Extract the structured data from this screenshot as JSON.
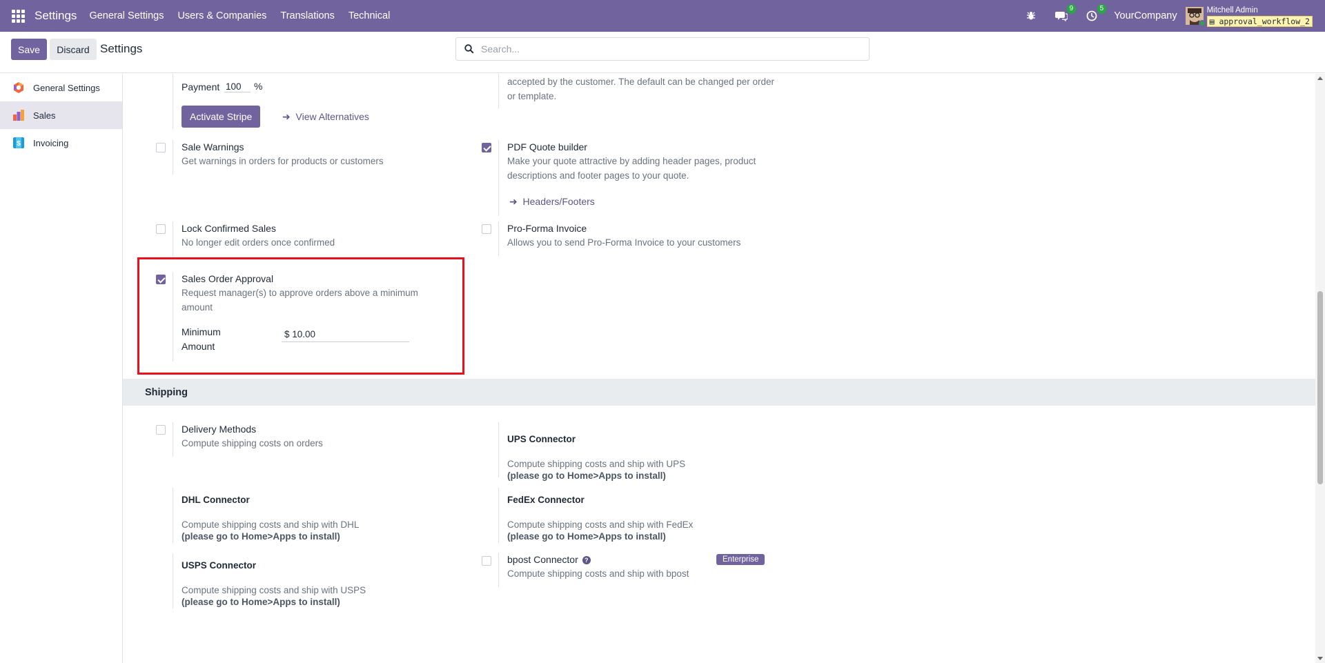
{
  "navbar": {
    "app_name": "Settings",
    "menu": [
      "General Settings",
      "Users & Companies",
      "Translations",
      "Technical"
    ],
    "messages_count": "9",
    "activities_count": "5",
    "company": "YourCompany",
    "user_name": "Mitchell Admin",
    "database": "approval_workflow_2"
  },
  "control": {
    "save": "Save",
    "discard": "Discard",
    "title": "Settings",
    "search_placeholder": "Search..."
  },
  "sidebar": {
    "items": [
      {
        "label": "General Settings",
        "icon": "general-settings-icon"
      },
      {
        "label": "Sales",
        "icon": "sales-icon",
        "active": true
      },
      {
        "label": "Invoicing",
        "icon": "invoicing-icon"
      }
    ]
  },
  "payment": {
    "label": "Payment",
    "value": "100",
    "unit": "%",
    "activate_button": "Activate Stripe",
    "alternatives_link": "View Alternatives"
  },
  "quote_validity_desc": "accepted by the customer. The default can be changed per order or template.",
  "settings": {
    "sale_warnings": {
      "title": "Sale Warnings",
      "desc": "Get warnings in orders for products or customers",
      "checked": false
    },
    "pdf_quote_builder": {
      "title": "PDF Quote builder",
      "desc": "Make your quote attractive by adding header pages, product descriptions and footer pages to your quote.",
      "link": "Headers/Footers",
      "checked": true
    },
    "lock_confirmed": {
      "title": "Lock Confirmed Sales",
      "desc": "No longer edit orders once confirmed",
      "checked": false
    },
    "pro_forma": {
      "title": "Pro-Forma Invoice",
      "desc": "Allows you to send Pro-Forma Invoice to your customers",
      "checked": false
    },
    "order_approval": {
      "title": "Sales Order Approval",
      "desc": "Request manager(s) to approve orders above a minimum amount",
      "min_label": "Minimum Amount",
      "min_value": "$ 10.00",
      "checked": true
    }
  },
  "shipping": {
    "section_title": "Shipping",
    "delivery_methods": {
      "title": "Delivery Methods",
      "desc": "Compute shipping costs on orders",
      "checked": false
    },
    "ups": {
      "title": "UPS Connector",
      "desc": "Compute shipping costs and ship with UPS",
      "note": "(please go to Home>Apps to install)"
    },
    "dhl": {
      "title": "DHL Connector",
      "desc": "Compute shipping costs and ship with DHL",
      "note": "(please go to Home>Apps to install)"
    },
    "fedex": {
      "title": "FedEx Connector",
      "desc": "Compute shipping costs and ship with FedEx",
      "note": "(please go to Home>Apps to install)"
    },
    "bpost": {
      "title": "bpost Connector",
      "desc": "Compute shipping costs and ship with bpost",
      "badge": "Enterprise",
      "help": "?"
    },
    "usps": {
      "title": "USPS Connector",
      "desc": "Compute shipping costs and ship with USPS",
      "note": "(please go to Home>Apps to install)"
    }
  },
  "colors": {
    "brand": "#71639e",
    "highlight": "#e8101a",
    "badge_green": "#28a745"
  }
}
